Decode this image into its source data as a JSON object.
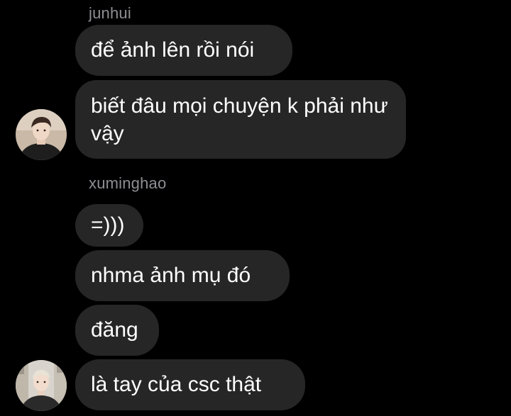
{
  "colors": {
    "background": "#000000",
    "bubble": "#262626",
    "text": "#ffffff",
    "sender": "#8e8e93"
  },
  "groups": [
    {
      "sender": "junhui",
      "messages": [
        "để ảnh lên rồi nói",
        "biết đâu mọi chuyện k phải như vậy"
      ],
      "avatar_icon": "profile-photo-icon"
    },
    {
      "sender": "xuminghao",
      "messages": [
        "=)))",
        "nhma ảnh mụ đó",
        "đăng",
        "là tay của csc thật"
      ],
      "avatar_icon": "profile-photo-icon"
    }
  ]
}
